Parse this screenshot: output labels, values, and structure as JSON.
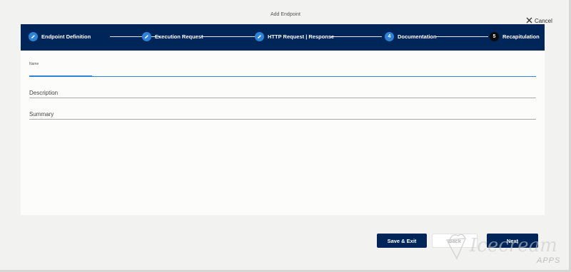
{
  "dialog": {
    "title": "Add Endpoint",
    "cancel_label": "Cancel"
  },
  "stepper": {
    "steps": [
      {
        "label": "Endpoint Definition",
        "marker": "",
        "state": "done"
      },
      {
        "label": "Execution Request",
        "marker": "",
        "state": "done"
      },
      {
        "label": "HTTP Request | Response",
        "marker": "",
        "state": "done"
      },
      {
        "label": "Documentation",
        "marker": "4",
        "state": "active"
      },
      {
        "label": "Recapitulation",
        "marker": "5",
        "state": "todo"
      }
    ]
  },
  "form": {
    "name_label": "Name",
    "description_label": "Description",
    "summary_label": "Summary"
  },
  "footer": {
    "save_exit_label": "Save & Exit",
    "back_label": "Back",
    "next_label": "Next"
  },
  "watermark": {
    "brand": "Icecream",
    "suffix": "APPS"
  },
  "colors": {
    "primary": "#002559",
    "accent": "#2e83d6",
    "background": "#f2f2f1"
  },
  "icons": {
    "cancel": "close-icon",
    "done_step": "pencil-icon"
  }
}
